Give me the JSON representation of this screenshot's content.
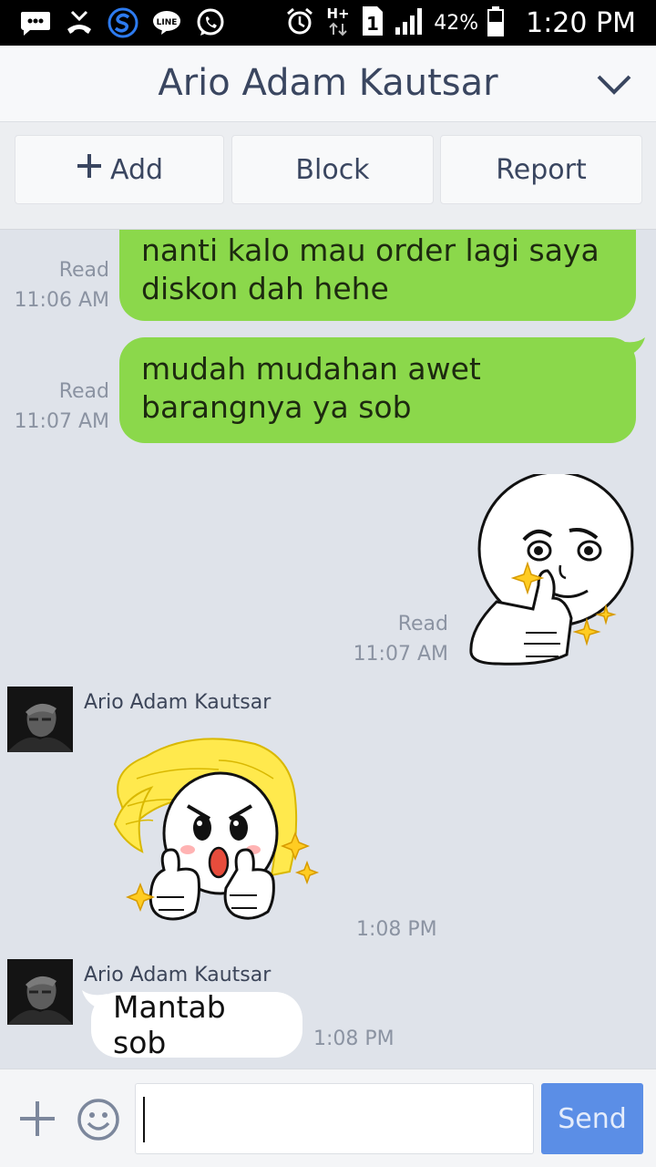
{
  "status_bar": {
    "battery_percent": "42%",
    "time": "1:20 PM",
    "network": "H+",
    "sim_slot": "1",
    "icons": [
      "messages-icon",
      "missed-call-icon",
      "s-app-icon",
      "line-icon",
      "whatsapp-icon",
      "alarm-icon",
      "data-icon",
      "sim-icon",
      "signal-icon",
      "battery-icon"
    ]
  },
  "header": {
    "title": "Ario Adam Kautsar"
  },
  "actions": {
    "add_label": "Add",
    "block_label": "Block",
    "report_label": "Report"
  },
  "messages": [
    {
      "type": "text",
      "direction": "out",
      "lines": [
        "nanti kalo mau order lagi saya",
        "diskon dah hehe"
      ],
      "status": "Read",
      "time": "11:06 AM"
    },
    {
      "type": "text",
      "direction": "out",
      "lines": [
        "mudah mudahan awet",
        "barangnya ya sob"
      ],
      "status": "Read",
      "time": "11:07 AM"
    },
    {
      "type": "sticker",
      "direction": "out",
      "sticker": "moon-thumbs-up-sticker",
      "status": "Read",
      "time": "11:07 AM"
    },
    {
      "type": "sticker",
      "direction": "in",
      "sender": "Ario Adam Kautsar",
      "sticker": "cony-thumbs-up-sticker",
      "time": "1:08 PM"
    },
    {
      "type": "text",
      "direction": "in",
      "sender": "Ario Adam Kautsar",
      "text": "Mantab sob",
      "time": "1:08 PM"
    }
  ],
  "input": {
    "value": "",
    "send_label": "Send"
  },
  "colors": {
    "outgoing_bubble": "#8bd84b",
    "incoming_bubble": "#ffffff",
    "chat_background": "#dfe3ea",
    "send_button": "#5b8ee6",
    "header_text": "#3a4660"
  }
}
